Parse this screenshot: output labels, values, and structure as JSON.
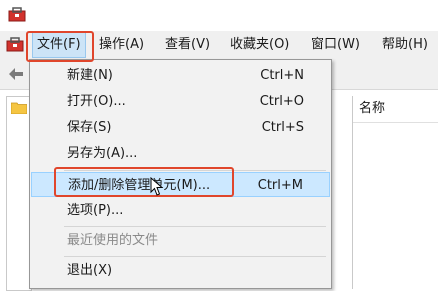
{
  "window": {
    "app_icon": "toolbox-icon"
  },
  "menubar": {
    "items": [
      {
        "label": "文件(F)",
        "active": true
      },
      {
        "label": "操作(A)"
      },
      {
        "label": "查看(V)"
      },
      {
        "label": "收藏夹(O)"
      },
      {
        "label": "窗口(W)"
      },
      {
        "label": "帮助(H)"
      }
    ]
  },
  "right_pane": {
    "column_header": "名称"
  },
  "file_menu": {
    "items": [
      {
        "label": "新建(N)",
        "shortcut": "Ctrl+N"
      },
      {
        "label": "打开(O)...",
        "shortcut": "Ctrl+O"
      },
      {
        "label": "保存(S)",
        "shortcut": "Ctrl+S"
      },
      {
        "label": "另存为(A)...",
        "shortcut": ""
      },
      {
        "label": "添加/删除管理单元(M)...",
        "shortcut": "Ctrl+M",
        "highlighted": true
      },
      {
        "label": "选项(P)...",
        "shortcut": ""
      },
      {
        "label": "最近使用的文件",
        "shortcut": "",
        "disabled": true
      },
      {
        "label": "退出(X)",
        "shortcut": ""
      }
    ]
  },
  "colors": {
    "highlight": "#cce8ff",
    "annotation": "#e0462c"
  }
}
